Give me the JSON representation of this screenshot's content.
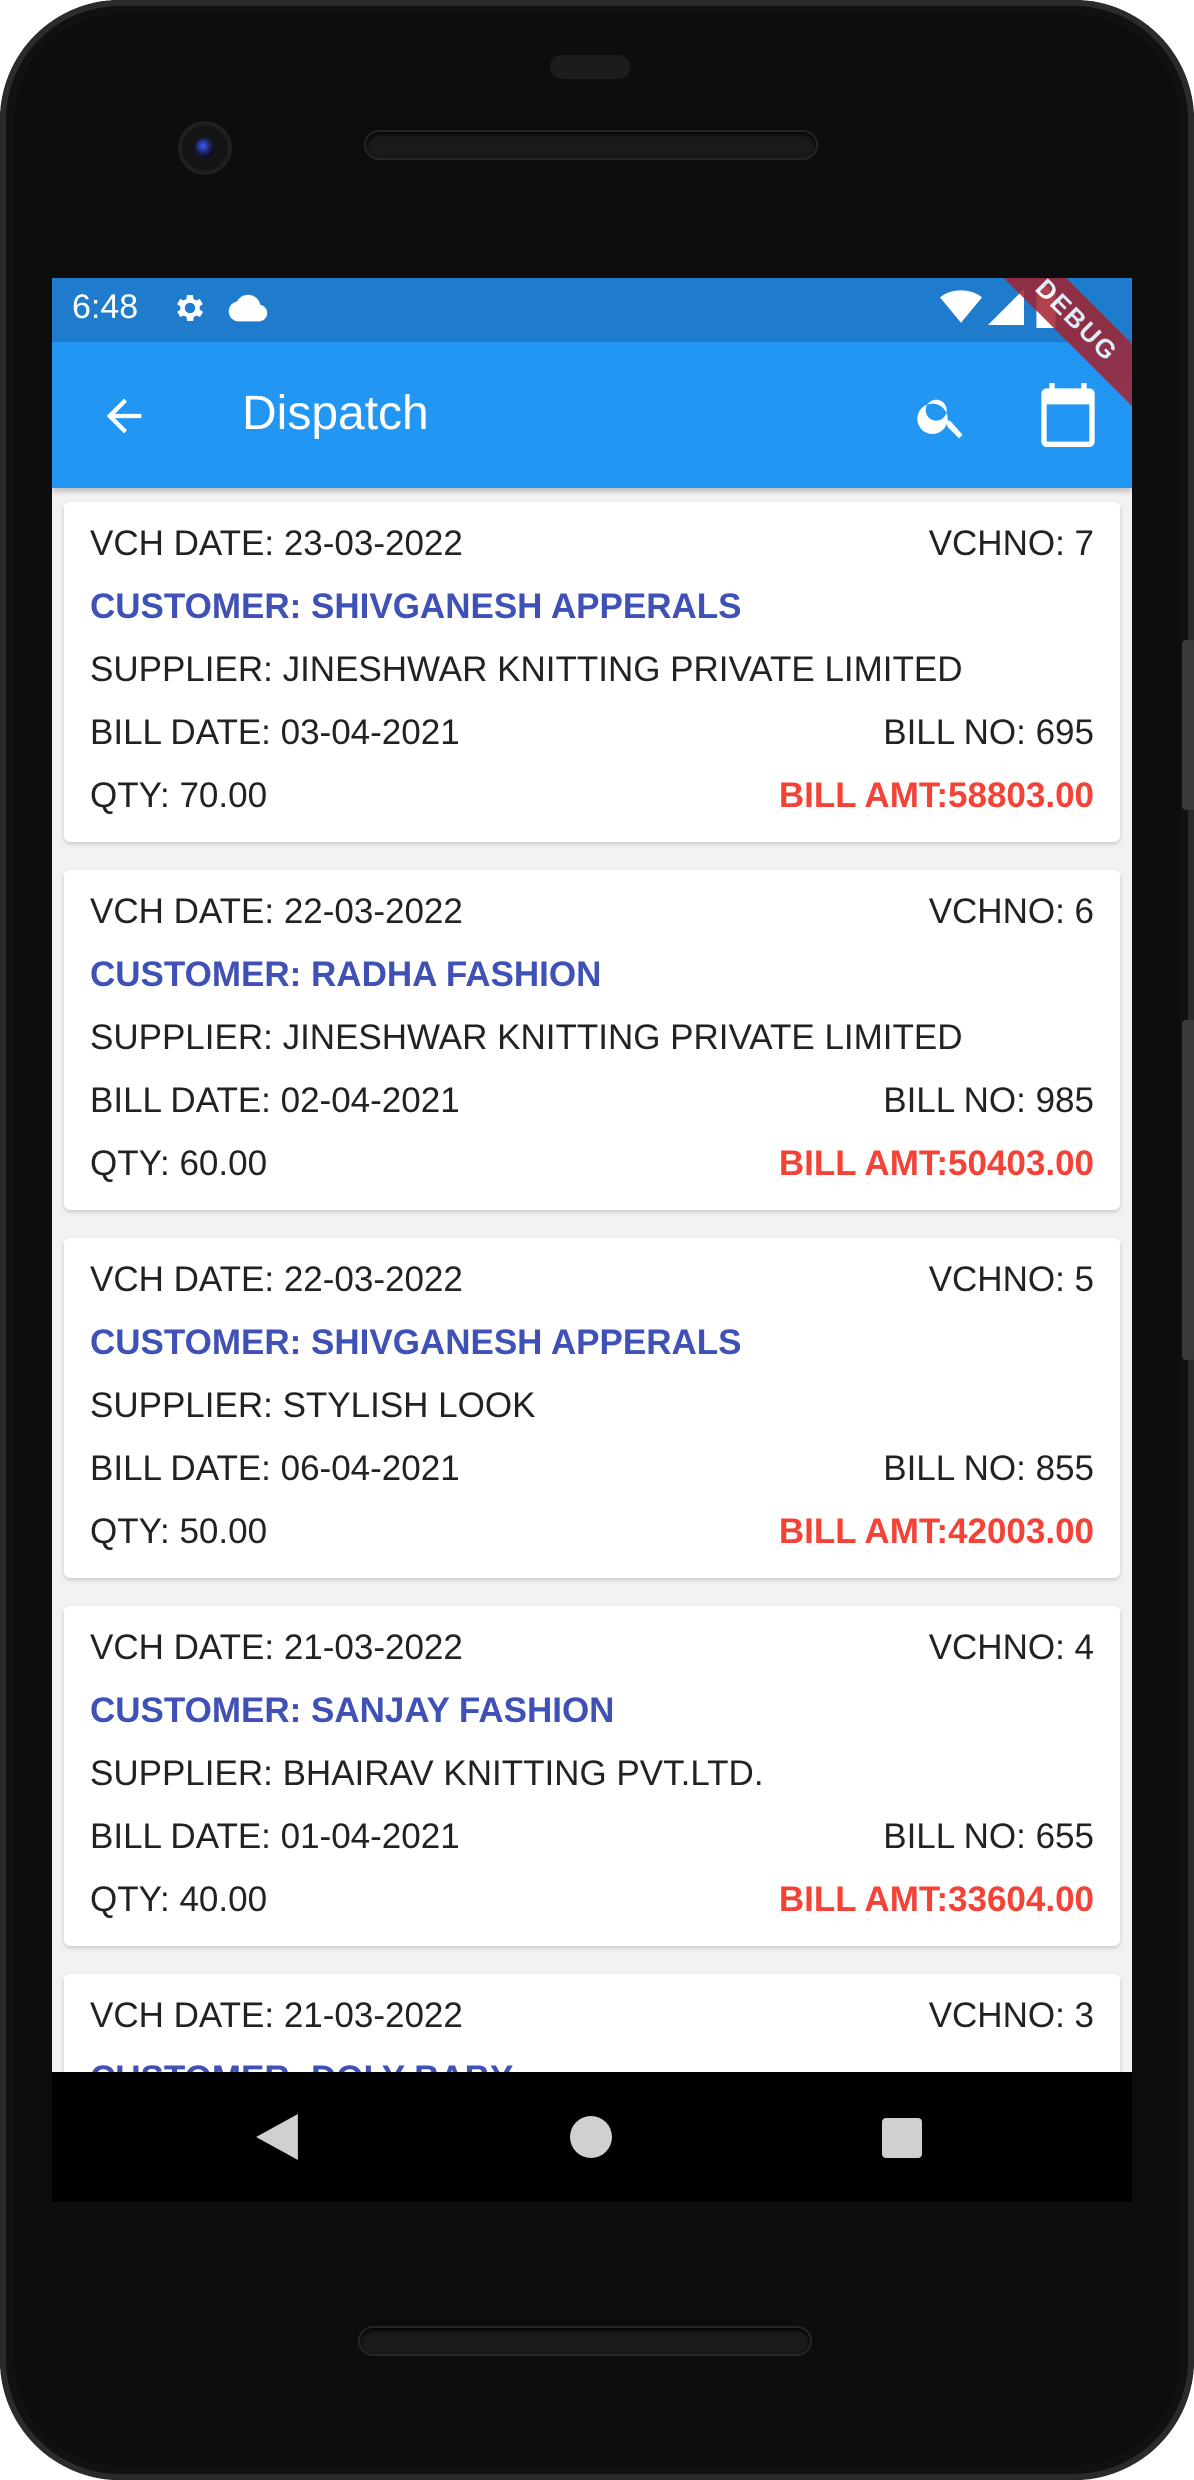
{
  "status_bar": {
    "time": "6:48",
    "icons": [
      "gear-icon",
      "cloud-icon",
      "wifi-icon",
      "signal-icon",
      "battery-icon"
    ]
  },
  "app_bar": {
    "title": "Dispatch",
    "back_icon": "arrow-back-icon",
    "search_icon": "search-icon",
    "calendar_icon": "calendar-icon",
    "debug_banner": "DEBUG"
  },
  "colors": {
    "status_bar": "#1f7ccc",
    "app_bar": "#2196f3",
    "customer_text": "#3f51b5",
    "amount_text": "#f44336"
  },
  "vouchers": [
    {
      "vch_date": "VCH DATE: 23-03-2022",
      "vch_no": "VCHNO: 7",
      "customer": "CUSTOMER: SHIVGANESH APPERALS",
      "supplier": "SUPPLIER: JINESHWAR KNITTING PRIVATE LIMITED",
      "bill_date": "BILL DATE: 03-04-2021",
      "bill_no": "BILL NO: 695",
      "qty": "QTY: 70.00",
      "bill_amt": "BILL AMT:58803.00"
    },
    {
      "vch_date": "VCH DATE: 22-03-2022",
      "vch_no": "VCHNO: 6",
      "customer": "CUSTOMER: RADHA FASHION",
      "supplier": "SUPPLIER: JINESHWAR KNITTING PRIVATE LIMITED",
      "bill_date": "BILL DATE: 02-04-2021",
      "bill_no": "BILL NO: 985",
      "qty": "QTY: 60.00",
      "bill_amt": "BILL AMT:50403.00"
    },
    {
      "vch_date": "VCH DATE: 22-03-2022",
      "vch_no": "VCHNO: 5",
      "customer": "CUSTOMER: SHIVGANESH APPERALS",
      "supplier": "SUPPLIER: STYLISH LOOK",
      "bill_date": "BILL DATE: 06-04-2021",
      "bill_no": "BILL NO: 855",
      "qty": "QTY: 50.00",
      "bill_amt": "BILL AMT:42003.00"
    },
    {
      "vch_date": "VCH DATE: 21-03-2022",
      "vch_no": "VCHNO: 4",
      "customer": "CUSTOMER: SANJAY FASHION",
      "supplier": "SUPPLIER: BHAIRAV KNITTING PVT.LTD.",
      "bill_date": "BILL DATE: 01-04-2021",
      "bill_no": "BILL NO: 655",
      "qty": "QTY: 40.00",
      "bill_amt": "BILL AMT:33604.00"
    },
    {
      "vch_date": "VCH DATE: 21-03-2022",
      "vch_no": "VCHNO: 3",
      "customer": "CUSTOMER: DOLY BABY"
    }
  ],
  "nav_bar": {
    "back": "nav-back-icon",
    "home": "nav-home-icon",
    "recents": "nav-recents-icon"
  }
}
